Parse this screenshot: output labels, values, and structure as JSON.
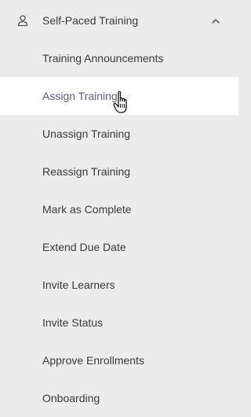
{
  "section": {
    "title": "Self-Paced Training",
    "icon": "user-icon",
    "toggle_icon": "chevron-up-icon"
  },
  "menu": {
    "items": [
      {
        "label": "Training Announcements"
      },
      {
        "label": "Assign Training",
        "active": true
      },
      {
        "label": "Unassign Training"
      },
      {
        "label": "Reassign Training"
      },
      {
        "label": "Mark as Complete"
      },
      {
        "label": "Extend Due Date"
      },
      {
        "label": "Invite Learners"
      },
      {
        "label": "Invite Status"
      },
      {
        "label": "Approve Enrollments"
      },
      {
        "label": "Onboarding"
      }
    ]
  },
  "colors": {
    "background": "#ececec",
    "active_background": "#ffffff",
    "active_text": "#5b5a8e",
    "text": "#3a3a3a"
  },
  "cursor": "hand-pointer-cursor"
}
